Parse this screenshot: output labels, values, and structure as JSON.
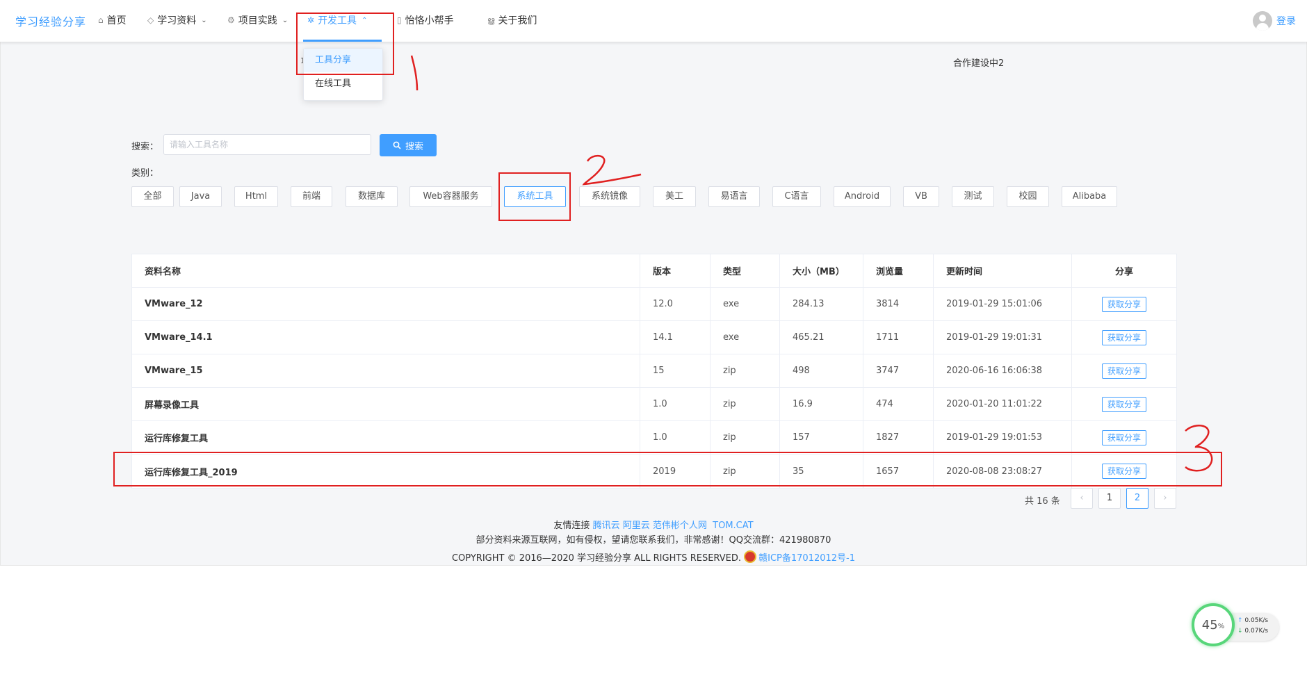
{
  "header": {
    "brand": "学习经验分享",
    "nav": [
      {
        "label": "首页",
        "icon": "home-icon"
      },
      {
        "label": "学习资料",
        "icon": "book-icon"
      },
      {
        "label": "项目实践",
        "icon": "gear-icon"
      },
      {
        "label": "开发工具",
        "icon": "tool-icon"
      },
      {
        "label": "怡恪小帮手",
        "icon": "bookmark-icon"
      },
      {
        "label": "关于我们",
        "icon": "users-icon"
      }
    ],
    "login": "登录",
    "accent_color": "#409eff"
  },
  "dropdown": {
    "items": [
      "工具分享",
      "在线工具"
    ],
    "stray_char": "1"
  },
  "coop_text": "合作建设中2",
  "search": {
    "label": "搜索：",
    "placeholder": "请输入工具名称",
    "value": "",
    "button": "搜索"
  },
  "categories": {
    "label": "类别：",
    "items": [
      "全部",
      "Java",
      "Html",
      "前端",
      "数据库",
      "Web容器服务",
      "系统工具",
      "系统镜像",
      "美工",
      "易语言",
      "C语言",
      "Android",
      "VB",
      "测试",
      "校园",
      "Alibaba"
    ],
    "selected": "系统工具"
  },
  "table": {
    "headers": [
      "资料名称",
      "版本",
      "类型",
      "大小（MB）",
      "浏览量",
      "更新时间",
      "分享"
    ],
    "share_label": "获取分享",
    "rows": [
      {
        "name": "VMware_12",
        "version": "12.0",
        "type": "exe",
        "size": "284.13",
        "views": "3814",
        "updated": "2019-01-29 15:01:06"
      },
      {
        "name": "VMware_14.1",
        "version": "14.1",
        "type": "exe",
        "size": "465.21",
        "views": "1711",
        "updated": "2019-01-29 19:01:31"
      },
      {
        "name": "VMware_15",
        "version": "15",
        "type": "zip",
        "size": "498",
        "views": "3747",
        "updated": "2020-06-16 16:06:38"
      },
      {
        "name": "屏幕录像工具",
        "version": "1.0",
        "type": "zip",
        "size": "16.9",
        "views": "474",
        "updated": "2020-01-20 11:01:22"
      },
      {
        "name": "运行库修复工具",
        "version": "1.0",
        "type": "zip",
        "size": "157",
        "views": "1827",
        "updated": "2019-01-29 19:01:53"
      },
      {
        "name": "运行库修复工具_2019",
        "version": "2019",
        "type": "zip",
        "size": "35",
        "views": "1657",
        "updated": "2020-08-08 23:08:27"
      }
    ]
  },
  "pagination": {
    "total": "共 16 条",
    "prev": "‹",
    "pages": [
      "1",
      "2"
    ],
    "current": "2",
    "next": "›"
  },
  "footer": {
    "links_label": "友情连接",
    "links": [
      "腾讯云",
      "阿里云",
      "范伟彬个人网",
      "TOM.CAT"
    ],
    "notice": "部分资料来源互联网，如有侵权，望请您联系我们，非常感谢！QQ交流群：421980870",
    "copyright": "COPYRIGHT © 2016—2020 学习经验分享 ALL RIGHTS RESERVED.",
    "icp": "赣ICP备17012012号-1"
  },
  "speed_widget": {
    "percent": "45",
    "unit": "%",
    "up": "0.05K/s",
    "down": "0.07K/s"
  }
}
